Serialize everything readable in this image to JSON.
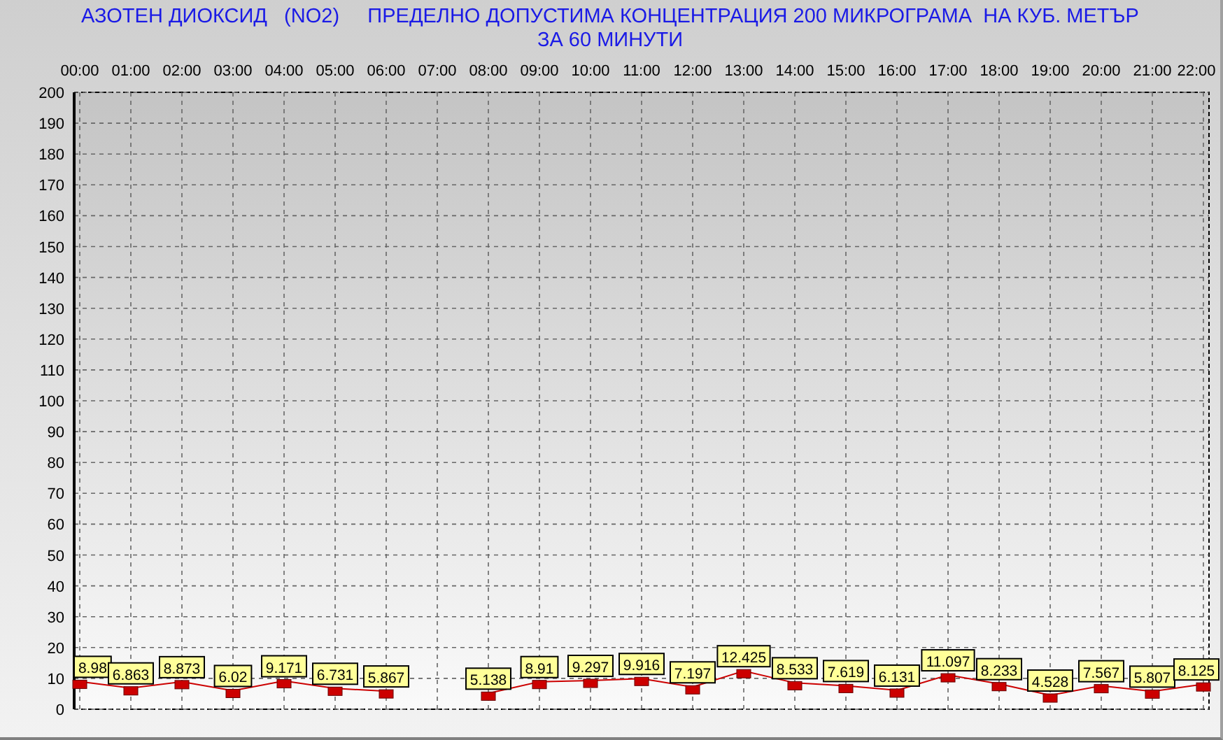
{
  "heading": {
    "lines": [
      "АЗОТЕН ДИОКСИД   (NO2)     ПРЕДЕЛНО ДОПУСТИМА КОНЦЕНТРАЦИЯ 200 МИКРОГРАМА  НА КУБ. МЕТЪР",
      "ЗА 60 МИНУТИ"
    ]
  },
  "chart": {
    "chart_data": {
      "type": "line",
      "categories": [
        "00:00",
        "01:00",
        "02:00",
        "03:00",
        "04:00",
        "05:00",
        "06:00",
        "07:00",
        "08:00",
        "09:00",
        "10:00",
        "11:00",
        "12:00",
        "13:00",
        "14:00",
        "15:00",
        "16:00",
        "17:00",
        "18:00",
        "19:00",
        "20:00",
        "21:00",
        "22:00"
      ],
      "series": [
        {
          "color": "#cc0000",
          "values": [
            8.98,
            6.863,
            8.873,
            6.02,
            9.171,
            6.731,
            5.867,
            null,
            5.138,
            8.91,
            9.297,
            9.916,
            7.197,
            12.425,
            8.533,
            7.619,
            6.131,
            11.097,
            8.233,
            4.528,
            7.567,
            5.807,
            8.125
          ]
        }
      ],
      "ylim": [
        0,
        200
      ],
      "yticks": [
        0,
        10,
        20,
        30,
        40,
        50,
        60,
        70,
        80,
        90,
        100,
        110,
        120,
        130,
        140,
        150,
        160,
        170,
        180,
        190,
        200
      ],
      "grid": true,
      "data_labels": true
    }
  }
}
